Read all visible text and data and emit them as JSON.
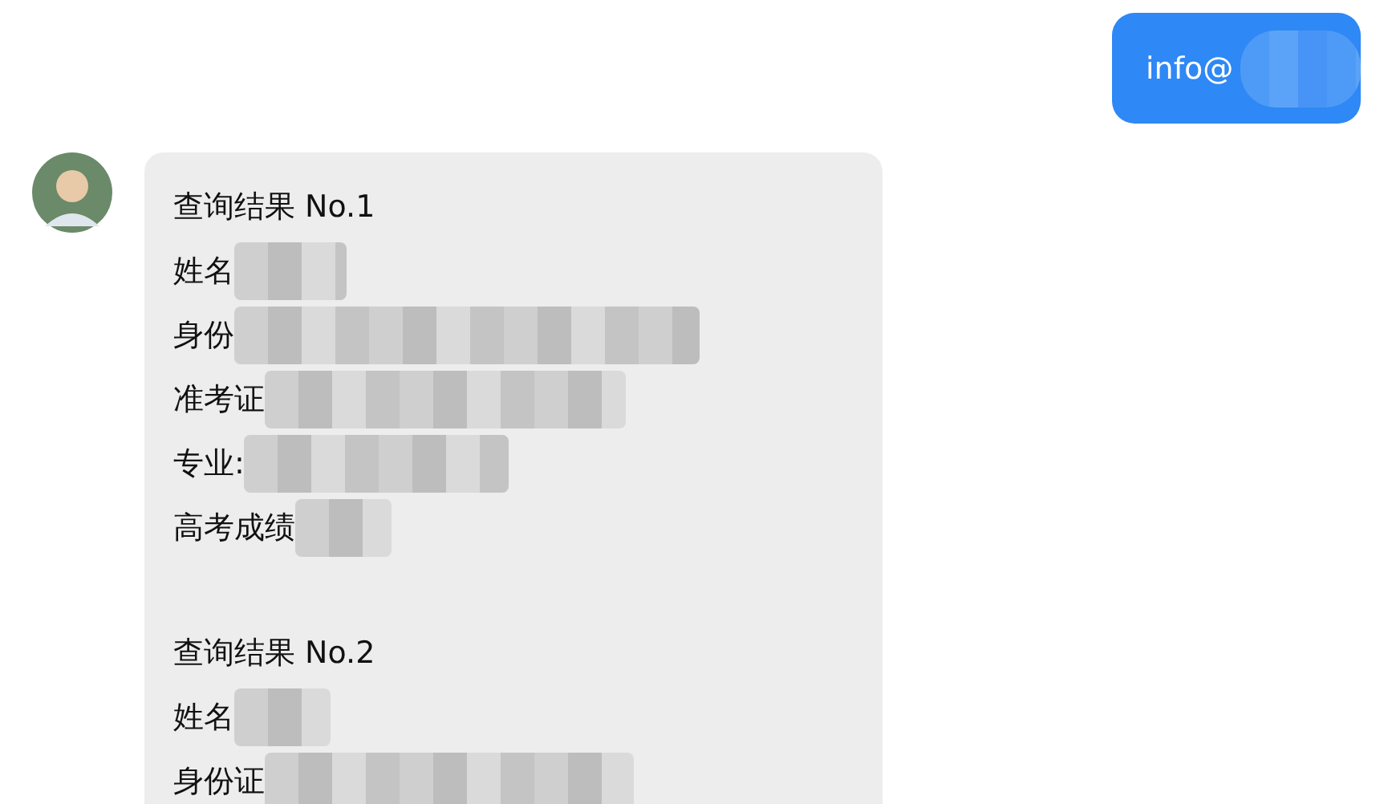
{
  "outgoing_message": {
    "text": "info@"
  },
  "incoming_message": {
    "results": [
      {
        "title": "查询结果 No.1",
        "lines": [
          "姓名",
          "身份",
          "准考证",
          "专业:",
          "高考成绩"
        ]
      },
      {
        "title": "查询结果 No.2",
        "lines": [
          "姓名",
          "身份证"
        ]
      }
    ]
  }
}
